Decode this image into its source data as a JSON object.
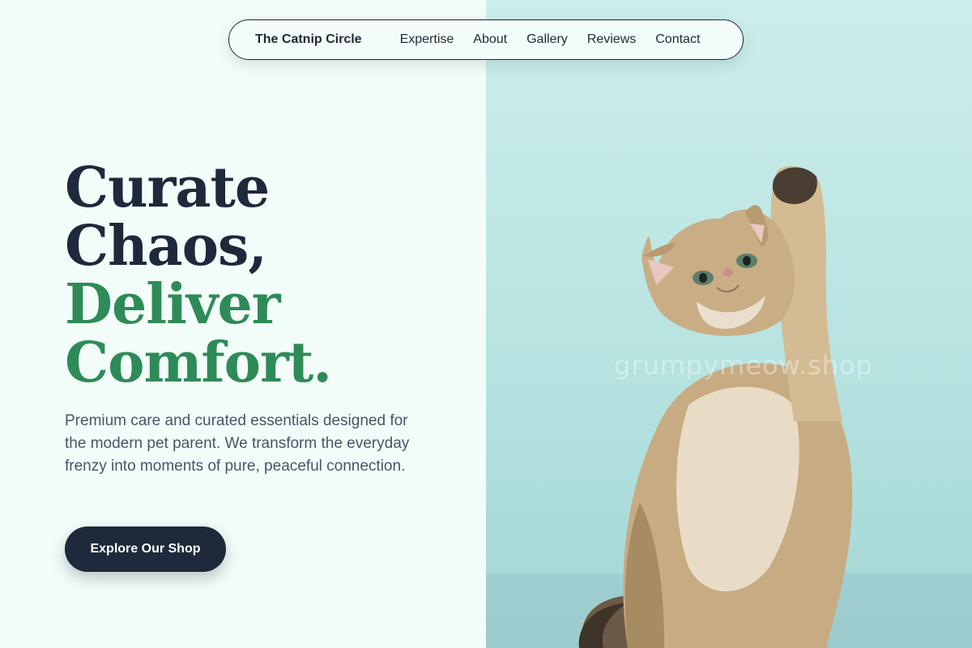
{
  "nav": {
    "brand": "The Catnip Circle",
    "links": [
      "Expertise",
      "About",
      "Gallery",
      "Reviews",
      "Contact"
    ]
  },
  "hero": {
    "headline_dark": [
      "Curate",
      "Chaos,"
    ],
    "headline_green": [
      "Deliver",
      "Comfort."
    ],
    "description": "Premium care and curated essentials designed for the modern pet parent. We transform the everyday frenzy into moments of pure, peaceful connection.",
    "cta_label": "Explore Our Shop"
  },
  "photo": {
    "subject": "kitten-raising-paw",
    "watermark": "grumpymeow.shop"
  },
  "colors": {
    "background": "#f2fcf8",
    "dark_text": "#1e293b",
    "accent_green": "#2e8b57",
    "body_text": "#475569",
    "photo_bg": "#b7e3e1"
  }
}
